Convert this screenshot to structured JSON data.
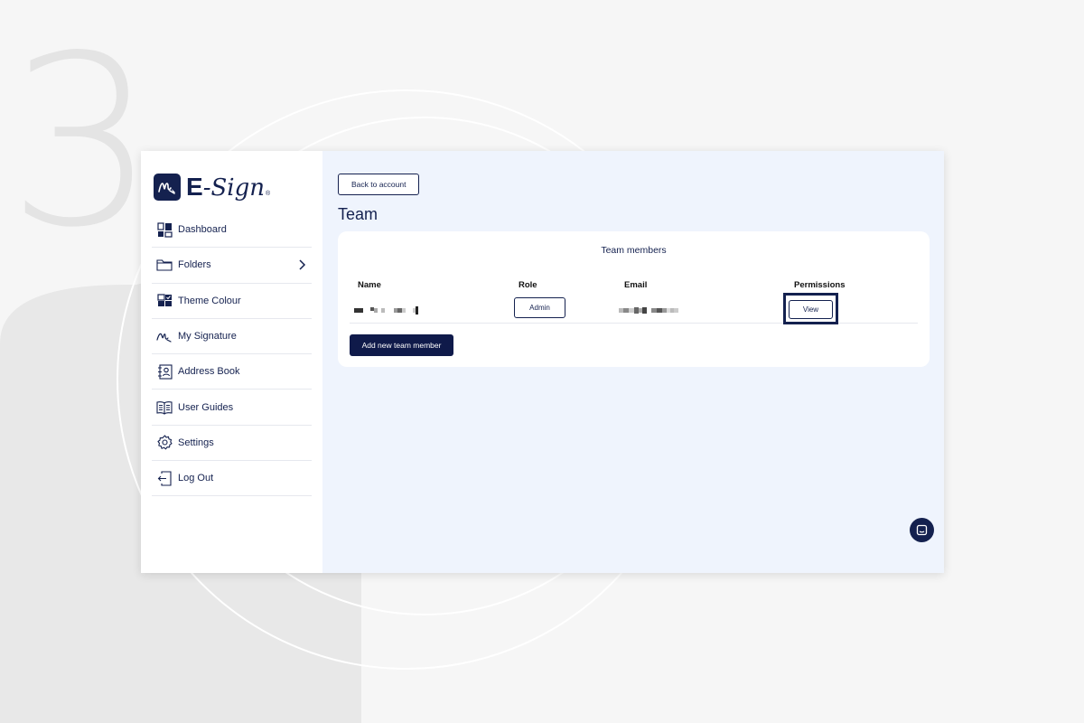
{
  "step_number": "3",
  "brand": {
    "logo_e": "E",
    "logo_sign": "-Sign",
    "logo_tm": "®"
  },
  "sidebar": {
    "items": [
      {
        "label": "Dashboard",
        "icon": "dashboard-icon"
      },
      {
        "label": "Folders",
        "icon": "folder-icon",
        "has_chevron": true
      },
      {
        "label": "Theme Colour",
        "icon": "theme-colour-icon"
      },
      {
        "label": "My Signature",
        "icon": "signature-icon"
      },
      {
        "label": "Address Book",
        "icon": "address-book-icon"
      },
      {
        "label": "User Guides",
        "icon": "user-guides-icon"
      },
      {
        "label": "Settings",
        "icon": "gear-icon"
      },
      {
        "label": "Log Out",
        "icon": "log-out-icon"
      }
    ]
  },
  "main": {
    "back_button": "Back to account",
    "page_title": "Team",
    "card": {
      "title": "Team members",
      "columns": [
        "Name",
        "Role",
        "Email",
        "Permissions"
      ],
      "rows": [
        {
          "name": "[pixelated]",
          "role": "Admin",
          "email": "[pixelated]",
          "permissions": "View"
        }
      ],
      "add_button": "Add new team member"
    }
  },
  "colors": {
    "brand_navy": "#14214f",
    "content_background": "#eff4fd",
    "page_background": "#f6f6f6"
  }
}
